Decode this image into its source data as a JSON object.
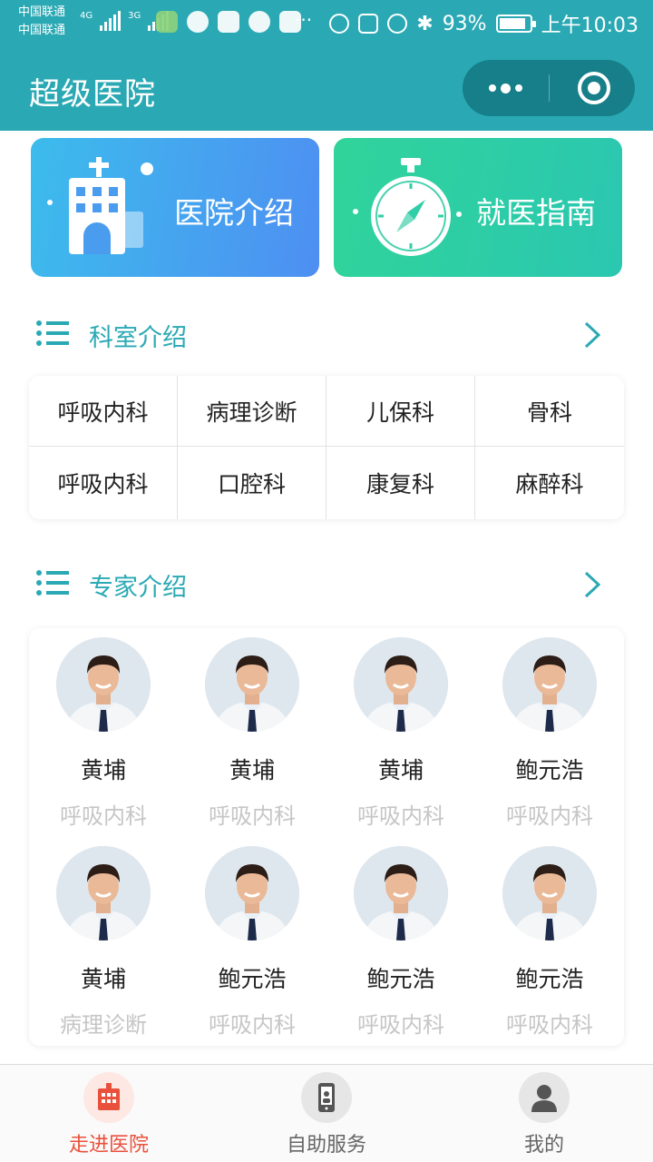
{
  "status_bar": {
    "carrier_1": "中国联通",
    "carrier_2": "中国联通",
    "net_1": "4G",
    "net_2": "3G",
    "more": "···",
    "battery": "93%",
    "time": "上午10:03",
    "icons": [
      "eye-icon",
      "nfc-icon",
      "alarm-icon",
      "bluetooth-icon",
      "battery-icon"
    ]
  },
  "navbar": {
    "title": "超级医院",
    "menu_icon": "more-dots-icon",
    "close_icon": "target-icon"
  },
  "banners": [
    {
      "label": "医院介绍",
      "icon": "hospital-building-icon",
      "color": "#4e8ff2"
    },
    {
      "label": "就医指南",
      "icon": "compass-stopwatch-icon",
      "color": "#30d49a"
    }
  ],
  "departments": {
    "title": "科室介绍",
    "items": [
      "呼吸内科",
      "病理诊断",
      "儿保科",
      "骨科",
      "呼吸内科",
      "口腔科",
      "康复科",
      "麻醉科"
    ]
  },
  "experts": {
    "title": "专家介绍",
    "items": [
      {
        "name": "黄埔",
        "dept": "呼吸内科"
      },
      {
        "name": "黄埔",
        "dept": "呼吸内科"
      },
      {
        "name": "黄埔",
        "dept": "呼吸内科"
      },
      {
        "name": "鲍元浩",
        "dept": "呼吸内科"
      },
      {
        "name": "黄埔",
        "dept": "病理诊断"
      },
      {
        "name": "鲍元浩",
        "dept": "呼吸内科"
      },
      {
        "name": "鲍元浩",
        "dept": "呼吸内科"
      },
      {
        "name": "鲍元浩",
        "dept": "呼吸内科"
      }
    ]
  },
  "tabbar": {
    "items": [
      {
        "label": "走进医院",
        "icon": "hospital-icon",
        "active": true
      },
      {
        "label": "自助服务",
        "icon": "phone-icon",
        "active": false
      },
      {
        "label": "我的",
        "icon": "user-icon",
        "active": false
      }
    ],
    "active_color": "#e9513c"
  },
  "colors": {
    "primary": "#2aa9b4",
    "capsule": "#167f89"
  }
}
